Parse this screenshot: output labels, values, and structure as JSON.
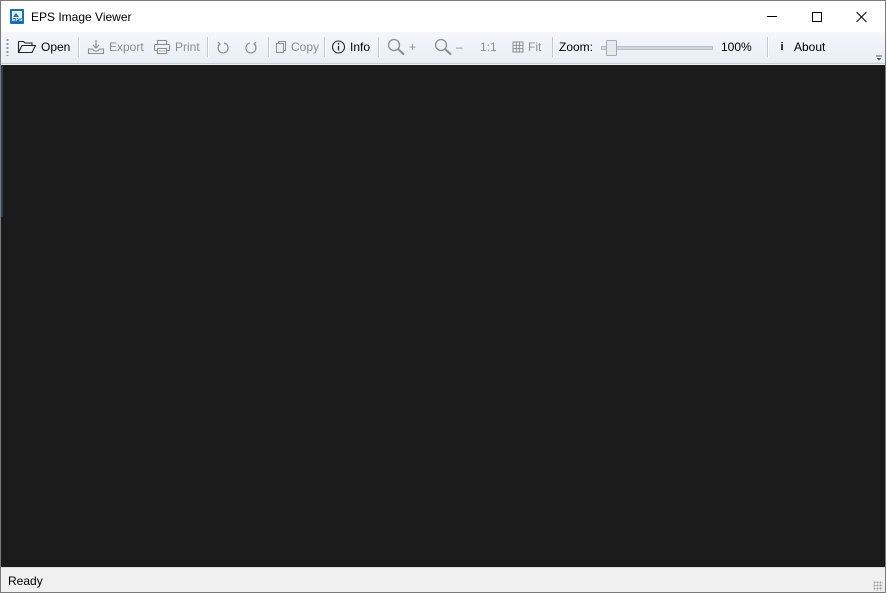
{
  "window": {
    "title": "EPS Image Viewer",
    "icon_text": "EPS"
  },
  "toolbar": {
    "open_label": "Open",
    "export_label": "Export",
    "print_label": "Print",
    "copy_label": "Copy",
    "info_label": "Info",
    "zoom_in_label": "+",
    "zoom_out_label": "–",
    "actual_size_label": "1:1",
    "fit_label": "Fit",
    "zoom_label": "Zoom:",
    "zoom_value": "100%",
    "zoom_level": 0.05,
    "about_label": "About",
    "about_glyph": "i"
  },
  "status": {
    "text": "Ready"
  },
  "colors": {
    "canvas_background": "#1b1b1b",
    "toolbar_background": "#eef1f7",
    "disabled_text": "#8d8d8d",
    "app_icon": "#1b6fb8"
  },
  "icons": {
    "open": "folder-open-icon",
    "export": "export-icon",
    "print": "printer-icon",
    "rotate_left": "rotate-left-icon",
    "rotate_right": "rotate-right-icon",
    "copy": "copy-icon",
    "info": "info-icon",
    "zoom_in": "zoom-in-icon",
    "zoom_out": "zoom-out-icon",
    "fit": "fit-grid-icon"
  }
}
